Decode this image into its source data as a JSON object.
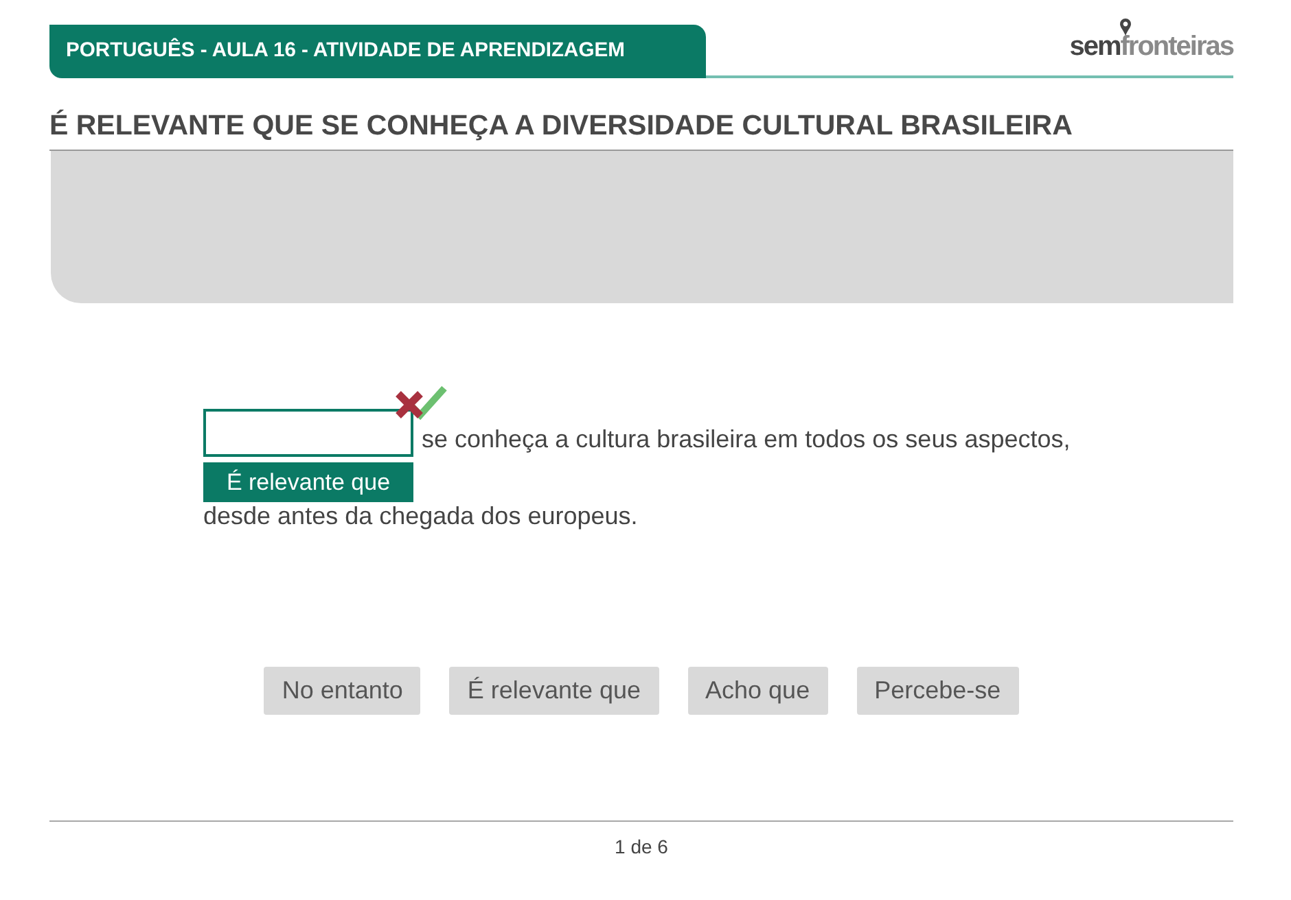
{
  "header": {
    "title": "PORTUGUÊS - AULA 16 - ATIVIDADE DE APRENDIZAGEM",
    "logo": "**sem**fronteiras"
  },
  "heading": "É RELEVANTE QUE SE CONHEÇA A DIVERSIDADE CULTURAL BRASILEIRA",
  "exercise": {
    "text_after_blank": "se conheça a cultura brasileira em todos os seus aspectos,",
    "answer_chip": "É relevante que",
    "text_end": "desde antes da chegada dos europeus."
  },
  "options": [
    "No entanto",
    "É relevante que",
    "Acho que",
    "Percebe-se"
  ],
  "pagination": "1 de 6"
}
